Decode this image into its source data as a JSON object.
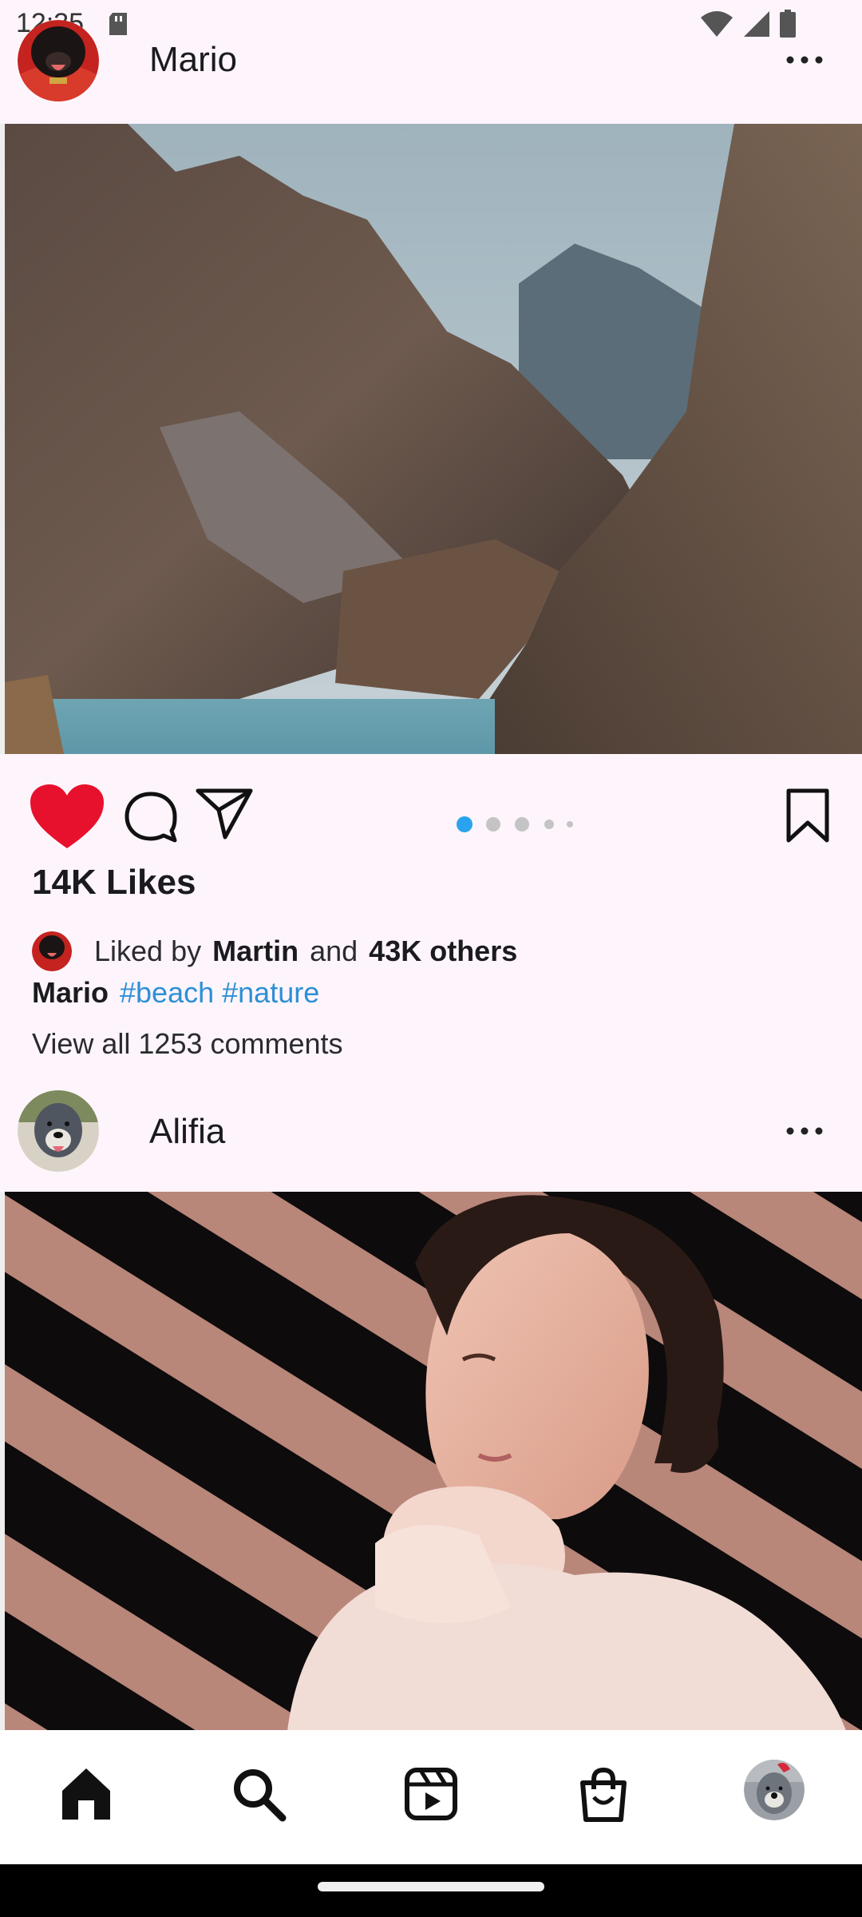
{
  "status_bar": {
    "time": "12:35"
  },
  "posts": [
    {
      "username": "Mario",
      "likes_text": "14K Likes",
      "liked_by": {
        "prefix": "Liked by",
        "name": "Martin",
        "conjunction": "and",
        "others": "43K others"
      },
      "caption": {
        "author": "Mario",
        "tags": [
          "#beach",
          "#nature"
        ]
      },
      "view_comments": "View all 1253 comments",
      "carousel_pages": 5,
      "carousel_active_page": 1
    },
    {
      "username": "Alifia"
    }
  ],
  "colors": {
    "background": "#fdf5fb",
    "heart": "#e8112d",
    "hashtag": "#2e8fd6",
    "carousel_active": "#2aa3ef",
    "carousel_inactive": "#c4c4c4"
  },
  "icons": {
    "like": "heart-icon",
    "comment": "comment-icon",
    "share": "send-icon",
    "save": "bookmark-icon",
    "more": "more-icon",
    "nav": [
      "home-icon",
      "search-icon",
      "reels-icon",
      "shop-icon",
      "profile-avatar"
    ]
  }
}
